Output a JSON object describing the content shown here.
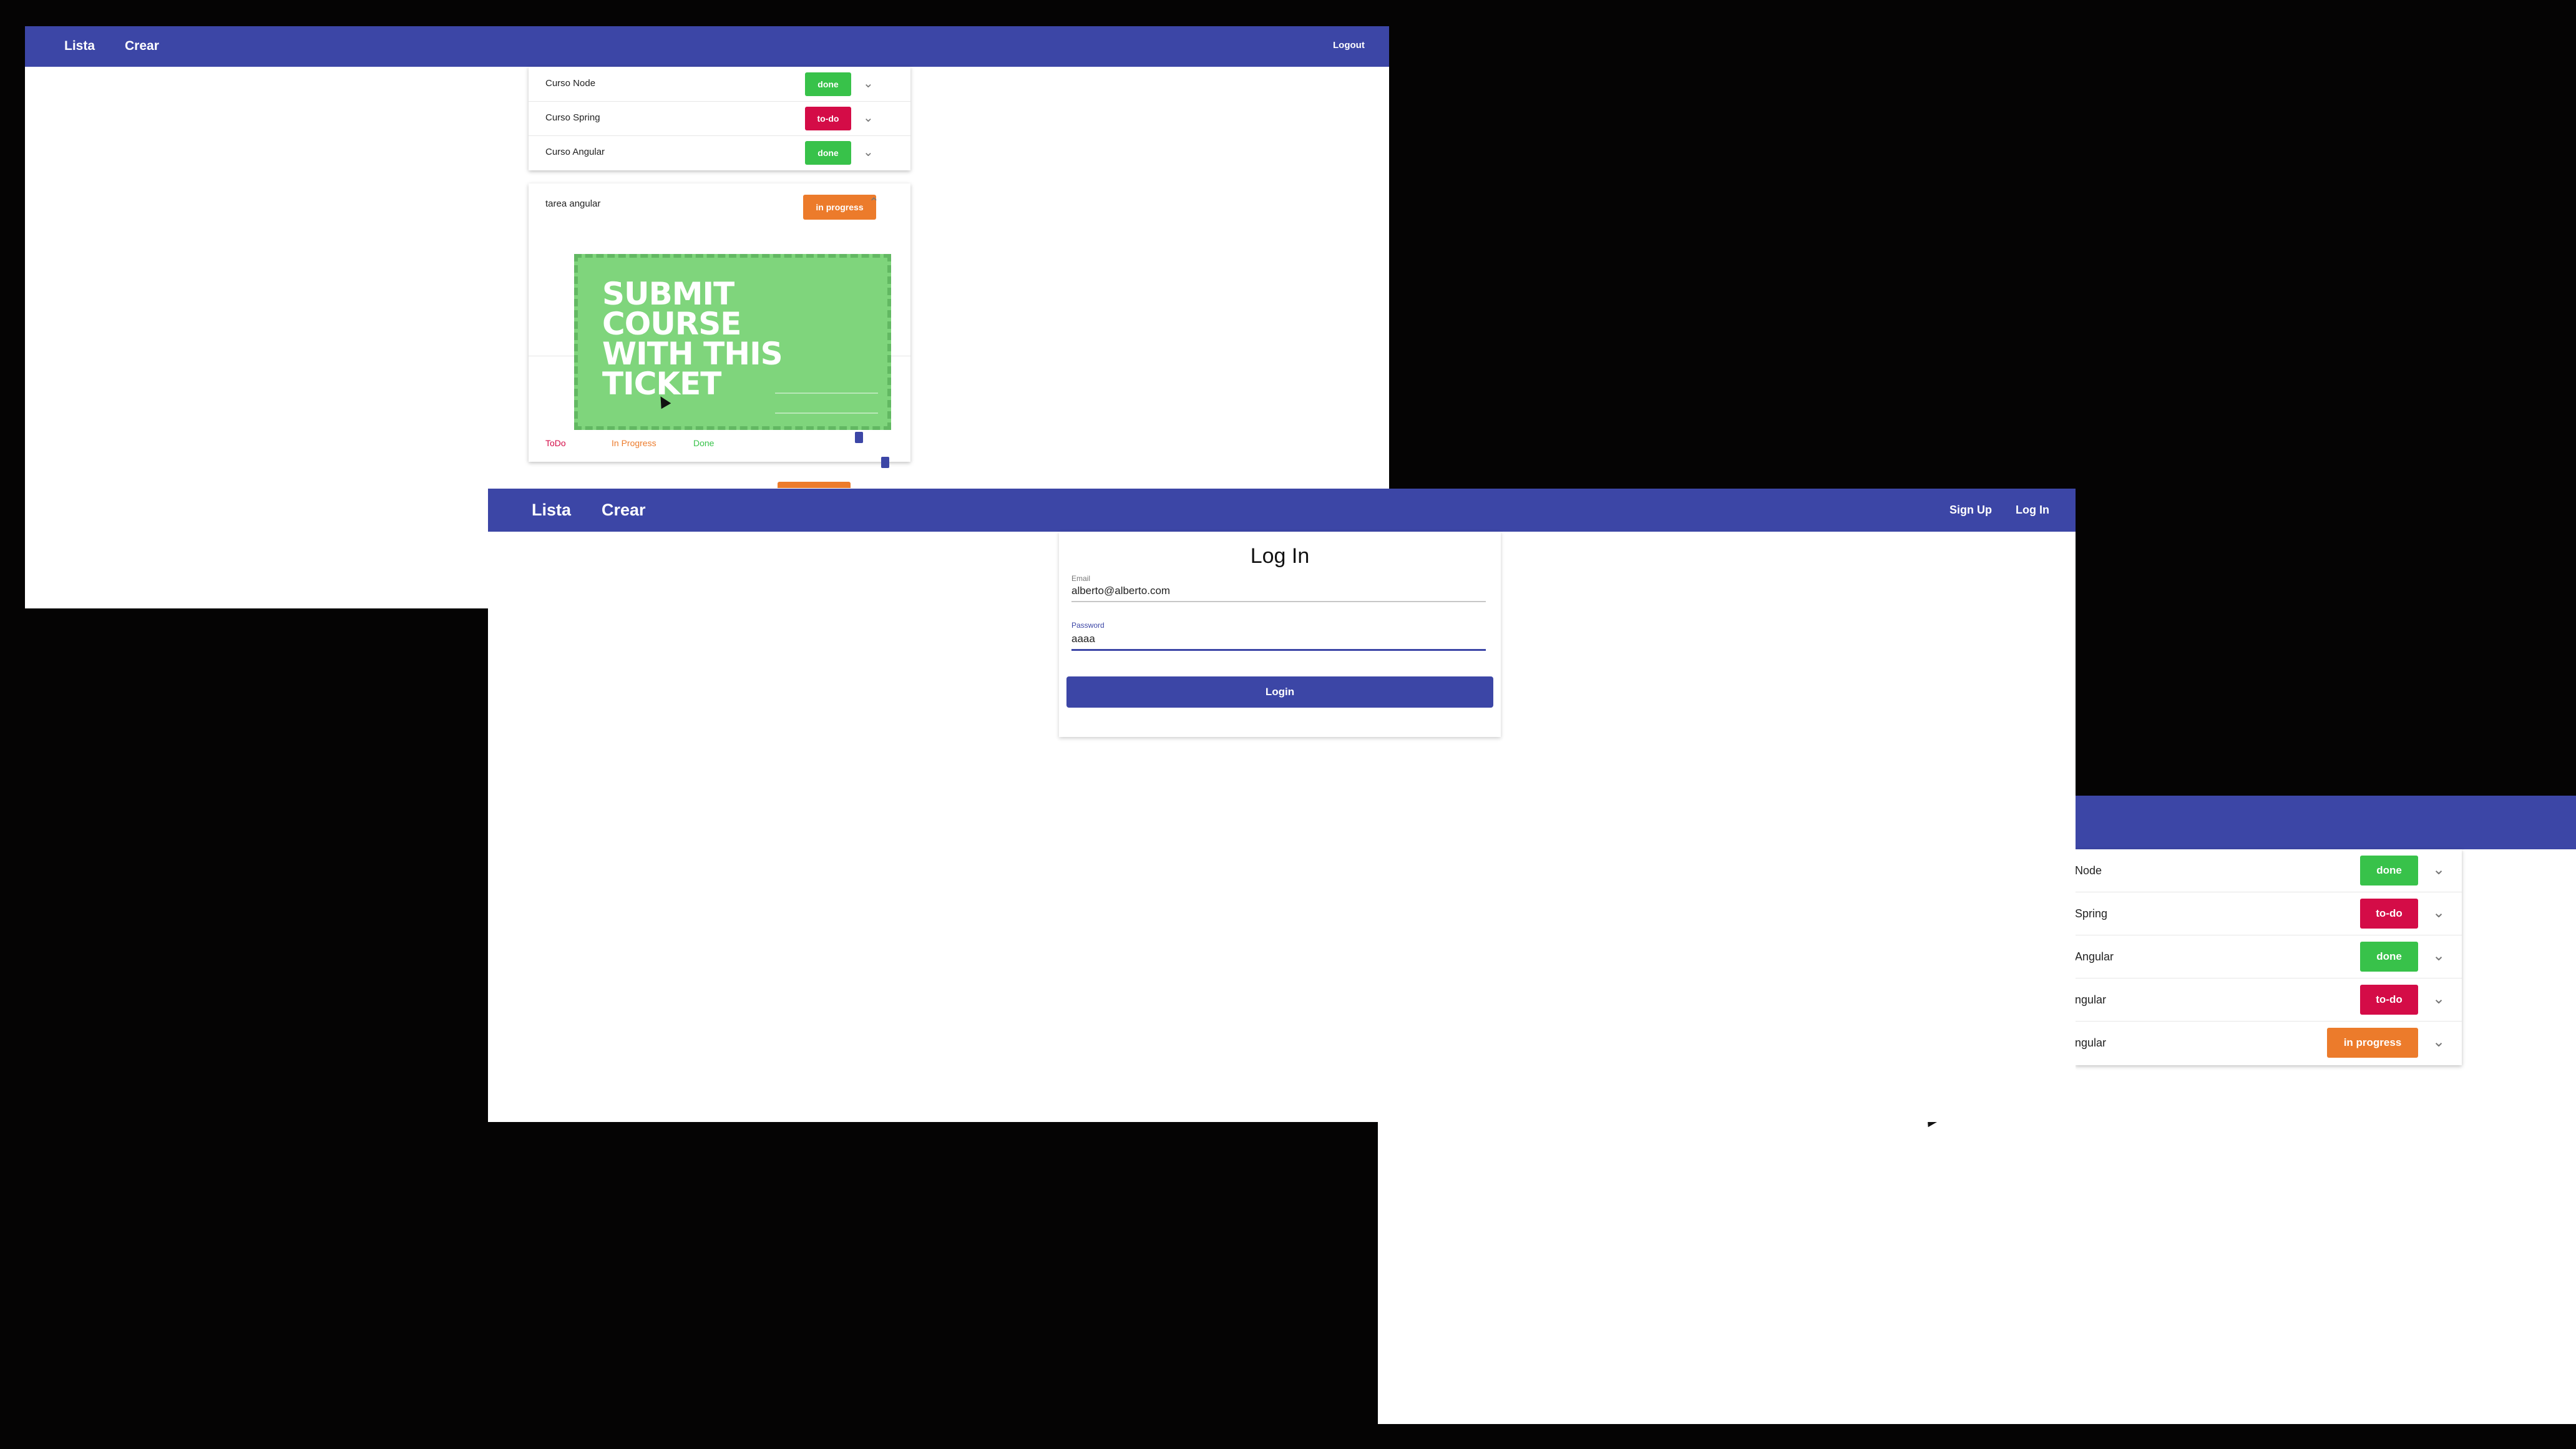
{
  "window_top": {
    "nav": {
      "lista": "Lista",
      "crear": "Crear",
      "logout": "Logout"
    },
    "tasks": [
      {
        "name": "Curso Node",
        "status": "done",
        "color": "#38c24a"
      },
      {
        "name": "Curso Spring",
        "status": "to-do",
        "color": "#d40c47"
      },
      {
        "name": "Curso Angular",
        "status": "done",
        "color": "#38c24a"
      }
    ],
    "expanded_task": {
      "name": "tarea angular",
      "status": "in progress",
      "image_text": "SUBMIT COURSE\nWITH THIS\nTICKET",
      "actions": {
        "todo": "ToDo",
        "in_progress": "In Progress",
        "done": "Done"
      }
    }
  },
  "window_login": {
    "nav": {
      "lista": "Lista",
      "crear": "Crear",
      "signup": "Sign Up",
      "login": "Log In"
    },
    "form": {
      "title": "Log In",
      "email_label": "Email",
      "email_value": "alberto@alberto.com",
      "password_label": "Password",
      "password_value": "aaaa",
      "submit": "Login"
    }
  },
  "window_right": {
    "tasks": [
      {
        "name": "Node",
        "status": "done"
      },
      {
        "name": "Spring",
        "status": "to-do"
      },
      {
        "name": "Angular",
        "status": "done"
      },
      {
        "name": "ngular",
        "status": "to-do"
      },
      {
        "name": "ngular",
        "status": "in progress"
      }
    ]
  },
  "colors": {
    "primary": "#3c46a6",
    "done": "#38c24a",
    "todo": "#d40c47",
    "in_progress": "#ec7b2b"
  }
}
